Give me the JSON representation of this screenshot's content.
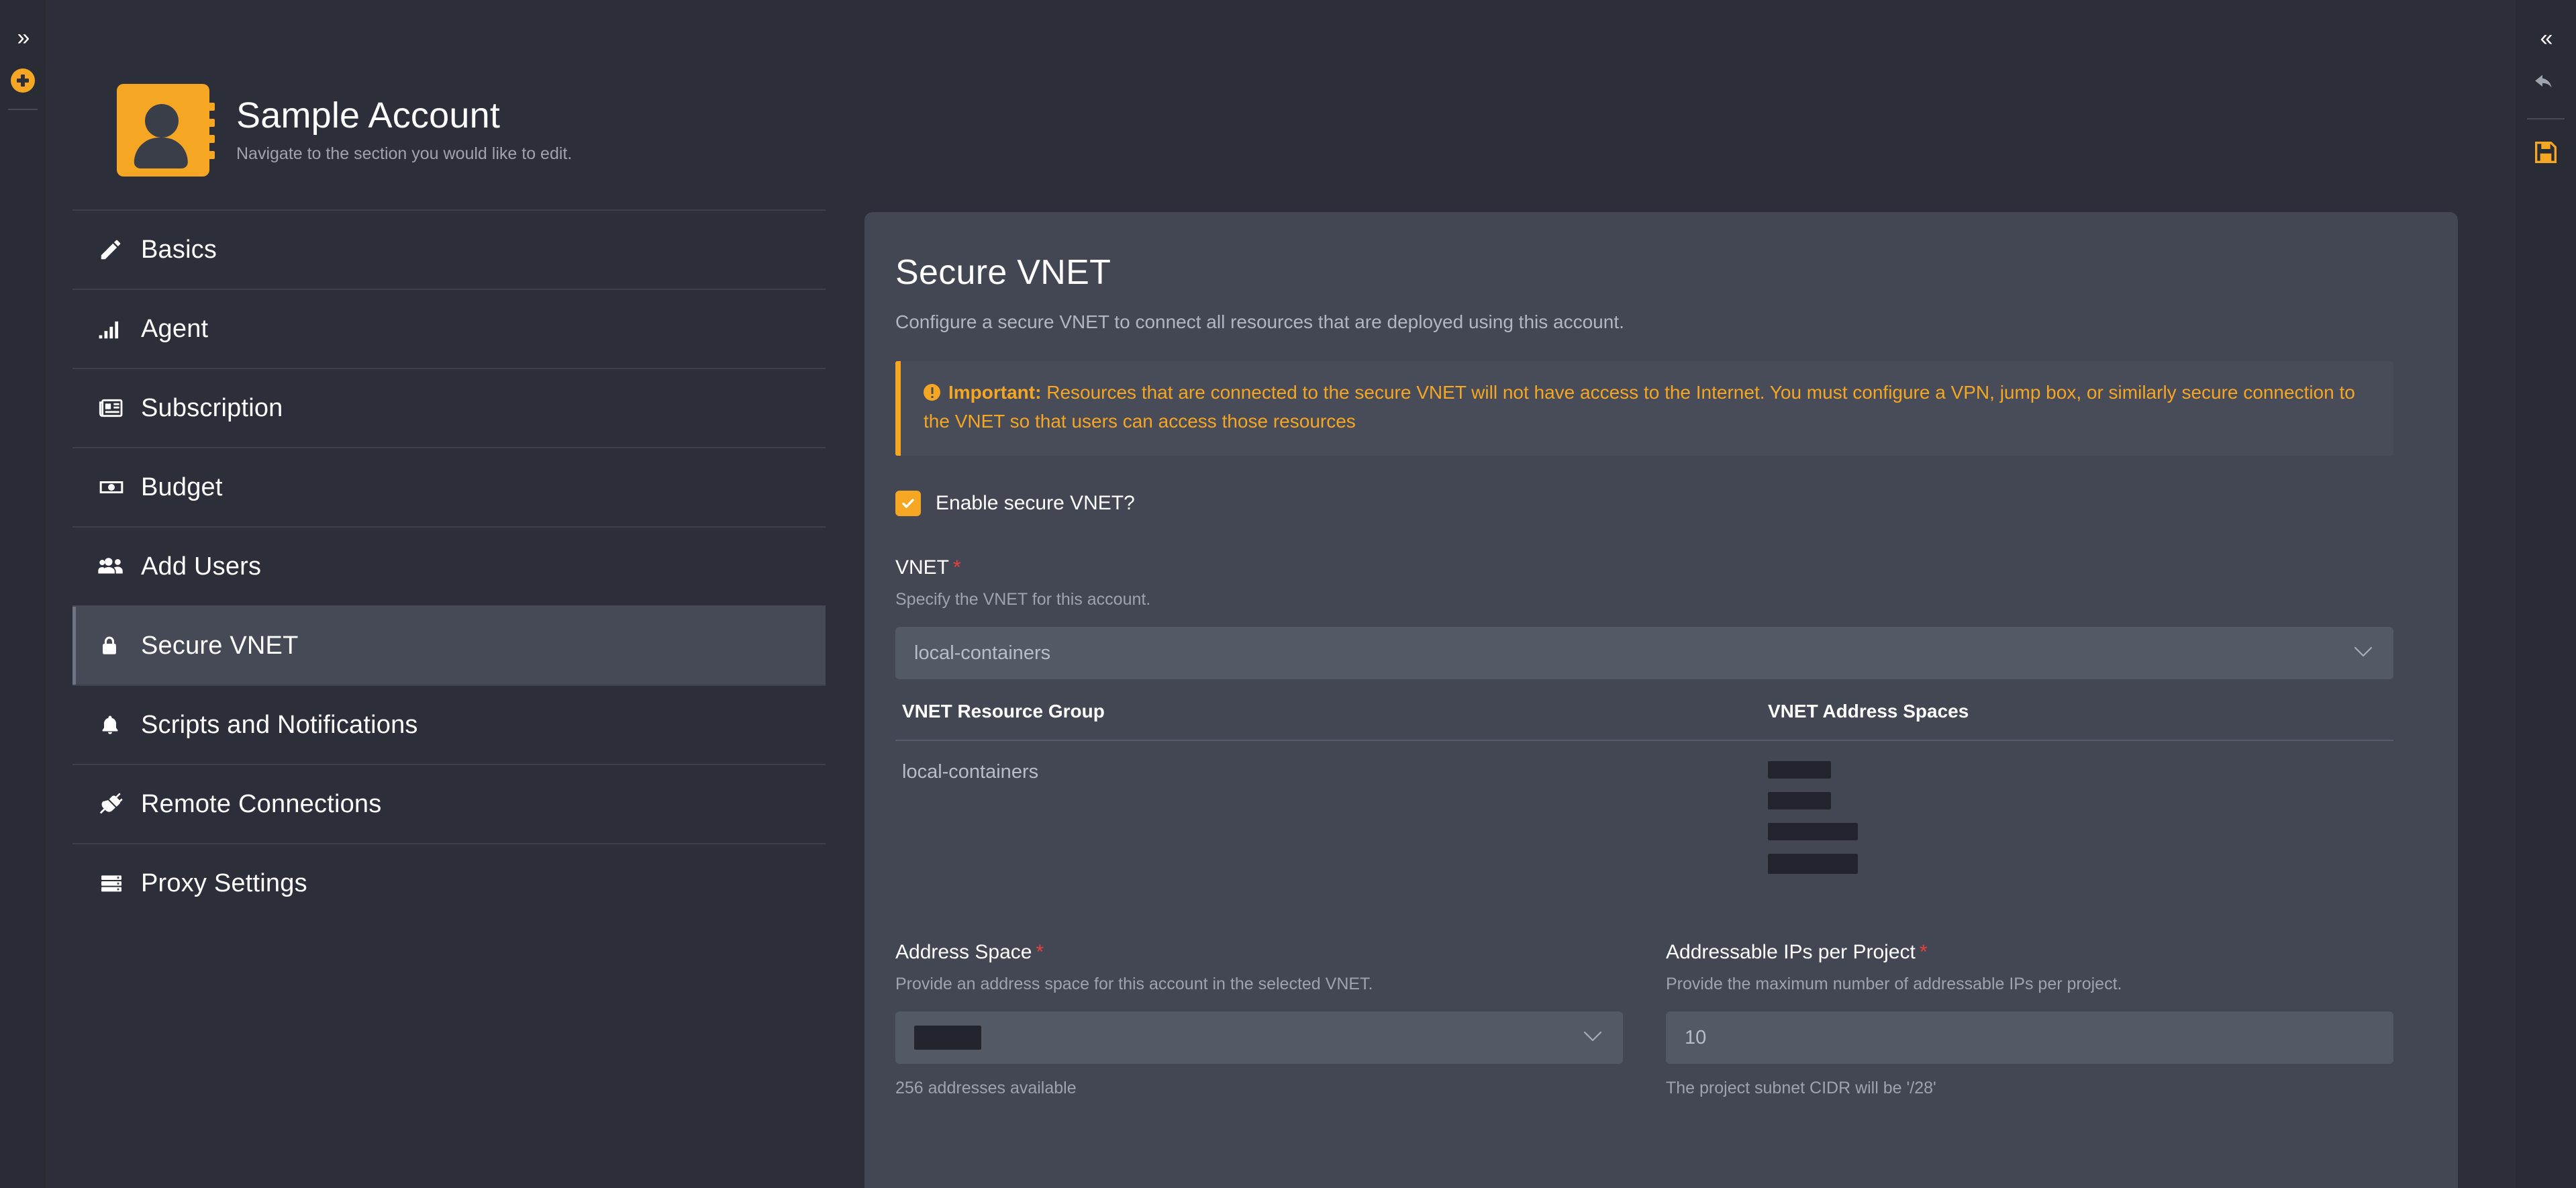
{
  "left_rail": {
    "expand_icon": "chevron-double-right-icon",
    "add_icon": "plus-circle-icon"
  },
  "account": {
    "avatar_icon": "contact-card-icon",
    "title": "Sample Account",
    "subtitle": "Navigate to the section you would like to edit."
  },
  "sidebar": {
    "items": [
      {
        "label": "Basics",
        "icon": "pencil-icon",
        "active": false
      },
      {
        "label": "Agent",
        "icon": "signal-bars-icon",
        "active": false
      },
      {
        "label": "Subscription",
        "icon": "newspaper-icon",
        "active": false
      },
      {
        "label": "Budget",
        "icon": "money-bill-icon",
        "active": false
      },
      {
        "label": "Add Users",
        "icon": "users-icon",
        "active": false
      },
      {
        "label": "Secure VNET",
        "icon": "lock-icon",
        "active": true
      },
      {
        "label": "Scripts and Notifications",
        "icon": "bell-icon",
        "active": false
      },
      {
        "label": "Remote Connections",
        "icon": "plug-icon",
        "active": false
      },
      {
        "label": "Proxy Settings",
        "icon": "server-icon",
        "active": false
      }
    ]
  },
  "panel": {
    "title": "Secure VNET",
    "subtitle": "Configure a secure VNET to connect all resources that are deployed using this account.",
    "alert": {
      "icon": "exclamation-circle-icon",
      "strong": "Important:",
      "text": "Resources that are connected to the secure VNET will not have access to the Internet. You must configure a VPN, jump box, or similarly secure connection to the VNET so that users can access those resources",
      "accent_color": "#f5a623"
    },
    "enable_checkbox": {
      "label": "Enable secure VNET?",
      "checked": true,
      "icon": "check-icon"
    },
    "vnet_field": {
      "label": "VNET",
      "required_marker": "*",
      "help": "Specify the VNET for this account.",
      "selected_value": "local-containers",
      "chevron_icon": "chevron-down-icon"
    },
    "vnet_table": {
      "columns": [
        "VNET Resource Group",
        "VNET Address Spaces"
      ],
      "rows": [
        {
          "resource_group": "local-containers",
          "address_spaces_redacted": [
            {
              "width": 78,
              "height": 26
            },
            {
              "width": 78,
              "height": 26
            },
            {
              "width": 110,
              "height": 26
            },
            {
              "width": 110,
              "height": 26
            }
          ]
        }
      ]
    },
    "address_space_field": {
      "label": "Address Space",
      "required_marker": "*",
      "help": "Provide an address space for this account in the selected VNET.",
      "value_redacted": {
        "width": 118,
        "height": 40
      },
      "chevron_icon": "chevron-down-icon",
      "note": "256 addresses available"
    },
    "addressable_ips_field": {
      "label": "Addressable IPs per Project",
      "required_marker": "*",
      "help": "Provide the maximum number of addressable IPs per project.",
      "value": "10",
      "note": "The project subnet CIDR will be '/28'"
    }
  },
  "right_rail": {
    "collapse_icon": "chevron-double-left-icon",
    "undo_icon": "undo-arrow-icon",
    "save_icon": "floppy-save-icon",
    "save_color": "#f5a623"
  },
  "colors": {
    "page_bg": "#2c2f3a",
    "panel_bg": "#434753",
    "rail_bg": "#292c35",
    "accent": "#f5a623",
    "required": "#e8403a",
    "active_nav": "#464a56",
    "redact": "#22252e"
  }
}
